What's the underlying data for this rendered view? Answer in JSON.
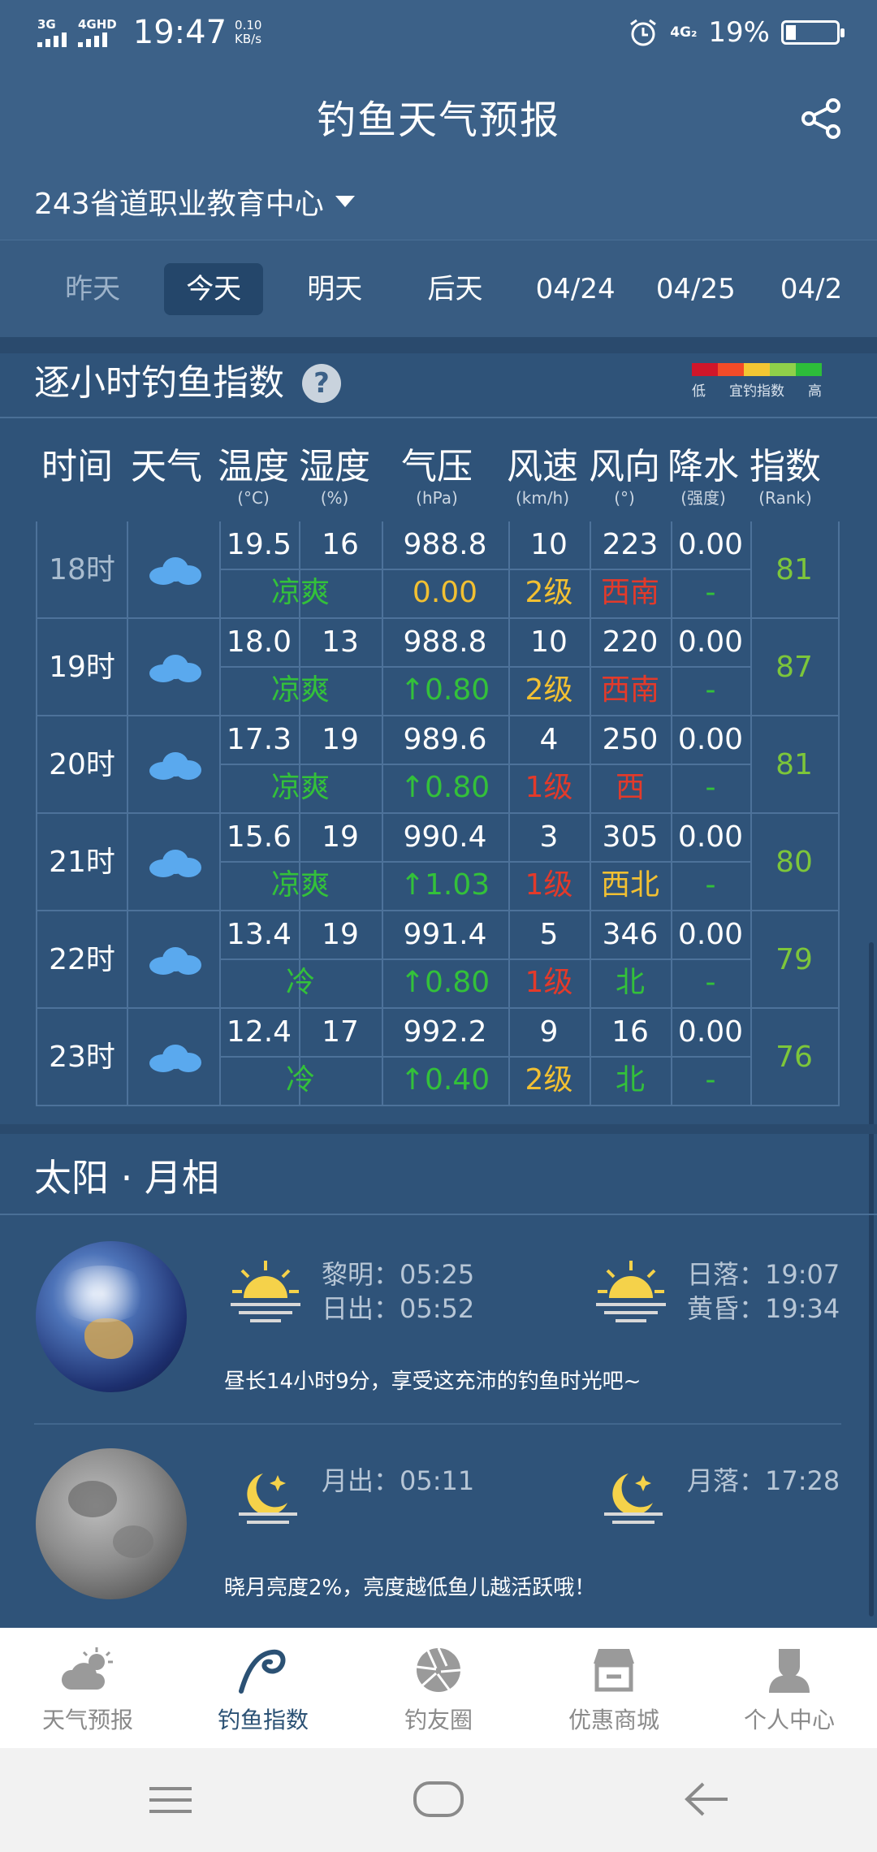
{
  "status_bar": {
    "net1": "3G",
    "net2": "4GHD",
    "time": "19:47",
    "speed_value": "0.10",
    "speed_unit": "KB/s",
    "net3": "4G₂",
    "battery": "19%"
  },
  "header": {
    "title": "钓鱼天气预报",
    "location": "243省道职业教育中心"
  },
  "day_tabs": [
    "昨天",
    "今天",
    "明天",
    "后天",
    "04/24",
    "04/25",
    "04/2"
  ],
  "hourly": {
    "title": "逐小时钓鱼指数",
    "help": "?",
    "legend": {
      "low": "低",
      "mid": "宜钓指数",
      "high": "高",
      "colors": [
        "#d0162a",
        "#f24b28",
        "#f2c633",
        "#8fd04a",
        "#2dbd3a"
      ]
    },
    "columns": [
      {
        "h": "时间",
        "u": ""
      },
      {
        "h": "天气",
        "u": ""
      },
      {
        "h": "温度",
        "u": "(°C)"
      },
      {
        "h": "湿度",
        "u": "(%)"
      },
      {
        "h": "气压",
        "u": "(hPa)"
      },
      {
        "h": "风速",
        "u": "(km/h)"
      },
      {
        "h": "风向",
        "u": "(°)"
      },
      {
        "h": "降水",
        "u": "(强度)"
      },
      {
        "h": "指数",
        "u": "(Rank)"
      }
    ],
    "rows": [
      {
        "time": "18时",
        "temp": "19.5",
        "hum": "16",
        "press": "988.8",
        "wind": "10",
        "dir": "223",
        "rain": "0.00",
        "feel": "凉爽",
        "pchg": "0.00",
        "level": "2级",
        "dirname": "西南",
        "rainlvl": "-",
        "rank": "81"
      },
      {
        "time": "19时",
        "temp": "18.0",
        "hum": "13",
        "press": "988.8",
        "wind": "10",
        "dir": "220",
        "rain": "0.00",
        "feel": "凉爽",
        "pchg": "↑0.80",
        "level": "2级",
        "dirname": "西南",
        "rainlvl": "-",
        "rank": "87"
      },
      {
        "time": "20时",
        "temp": "17.3",
        "hum": "19",
        "press": "989.6",
        "wind": "4",
        "dir": "250",
        "rain": "0.00",
        "feel": "凉爽",
        "pchg": "↑0.80",
        "level": "1级",
        "dirname": "西",
        "rainlvl": "-",
        "rank": "81"
      },
      {
        "time": "21时",
        "temp": "15.6",
        "hum": "19",
        "press": "990.4",
        "wind": "3",
        "dir": "305",
        "rain": "0.00",
        "feel": "凉爽",
        "pchg": "↑1.03",
        "level": "1级",
        "dirname": "西北",
        "rainlvl": "-",
        "rank": "80"
      },
      {
        "time": "22时",
        "temp": "13.4",
        "hum": "19",
        "press": "991.4",
        "wind": "5",
        "dir": "346",
        "rain": "0.00",
        "feel": "冷",
        "pchg": "↑0.80",
        "level": "1级",
        "dirname": "北",
        "rainlvl": "-",
        "rank": "79"
      },
      {
        "time": "23时",
        "temp": "12.4",
        "hum": "17",
        "press": "992.2",
        "wind": "9",
        "dir": "16",
        "rain": "0.00",
        "feel": "冷",
        "pchg": "↑0.40",
        "level": "2级",
        "dirname": "北",
        "rainlvl": "-",
        "rank": "76"
      }
    ]
  },
  "sun_moon": {
    "title": "太阳 · 月相",
    "dawn": "黎明：05:25",
    "sunrise": "日出：05:52",
    "sunset": "日落：19:07",
    "dusk": "黄昏：19:34",
    "sun_note": "昼长14小时9分，享受这充沛的钓鱼时光吧~",
    "moonrise": "月出：05:11",
    "moonset": "月落：17:28",
    "moon_note": "晓月亮度2%，亮度越低鱼儿越活跃哦！"
  },
  "bottom_nav": [
    "天气预报",
    "钓鱼指数",
    "钓友圈",
    "优惠商城",
    "个人中心"
  ]
}
